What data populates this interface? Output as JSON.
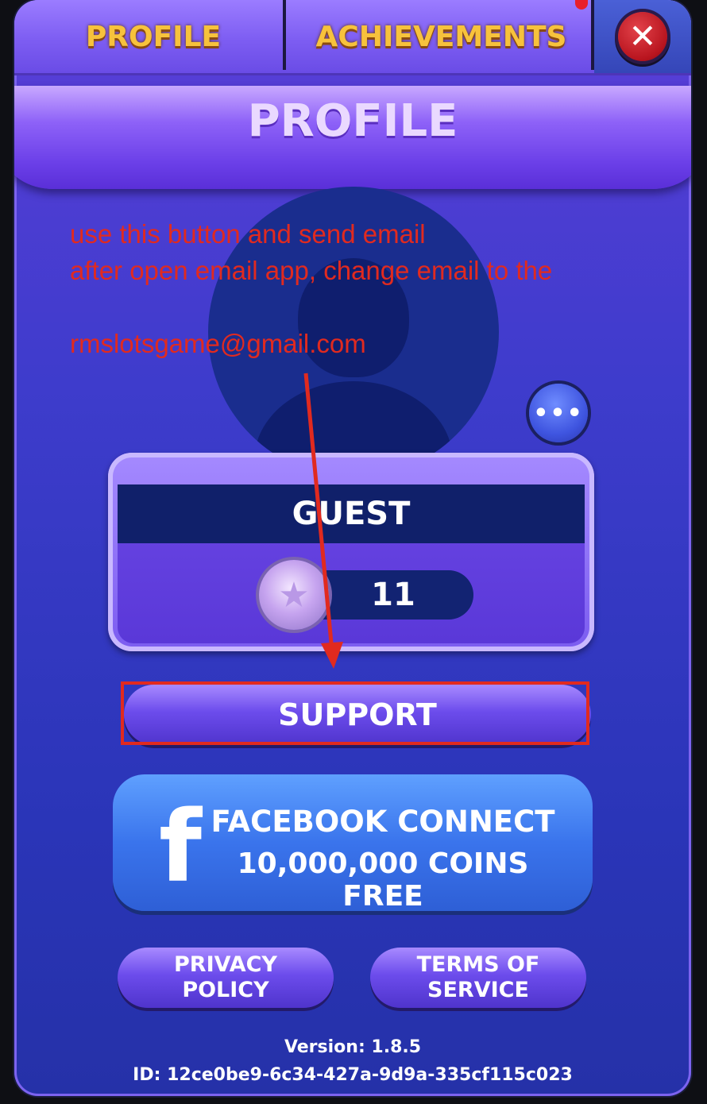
{
  "tabs": [
    {
      "label": "PROFILE"
    },
    {
      "label": "ACHIEVEMENTS"
    }
  ],
  "close_label": "✕",
  "header": {
    "title": "PROFILE"
  },
  "more_label": "•••",
  "player": {
    "name": "GUEST",
    "level": "11"
  },
  "buttons": {
    "support": "SUPPORT",
    "facebook_line1": "FACEBOOK CONNECT",
    "facebook_line2": "10,000,000 COINS FREE",
    "facebook_icon_glyph": "f",
    "privacy_line1": "PRIVACY",
    "privacy_line2": "POLICY",
    "terms_line1": "TERMS OF",
    "terms_line2": "SERVICE"
  },
  "footer": {
    "version": "Version: 1.8.5",
    "id": "ID: 12ce0be9-6c34-427a-9d9a-335cf115c023"
  },
  "annotation": {
    "line1": "use this button and send email",
    "line2": "after open email app, change email to the",
    "line3": "rmslotsgame@gmail.com",
    "color": "#e12a1f"
  },
  "icons": {
    "close": "close-icon",
    "more": "more-dots-icon",
    "avatar": "user-silhouette-icon",
    "level_badge": "star-badge-icon",
    "facebook": "facebook-logo-icon"
  },
  "colors": {
    "tab_text": "#f7c23c",
    "panel": "#3e3ccc",
    "facebook": "#3a74ec",
    "close_button": "#c8182a"
  }
}
